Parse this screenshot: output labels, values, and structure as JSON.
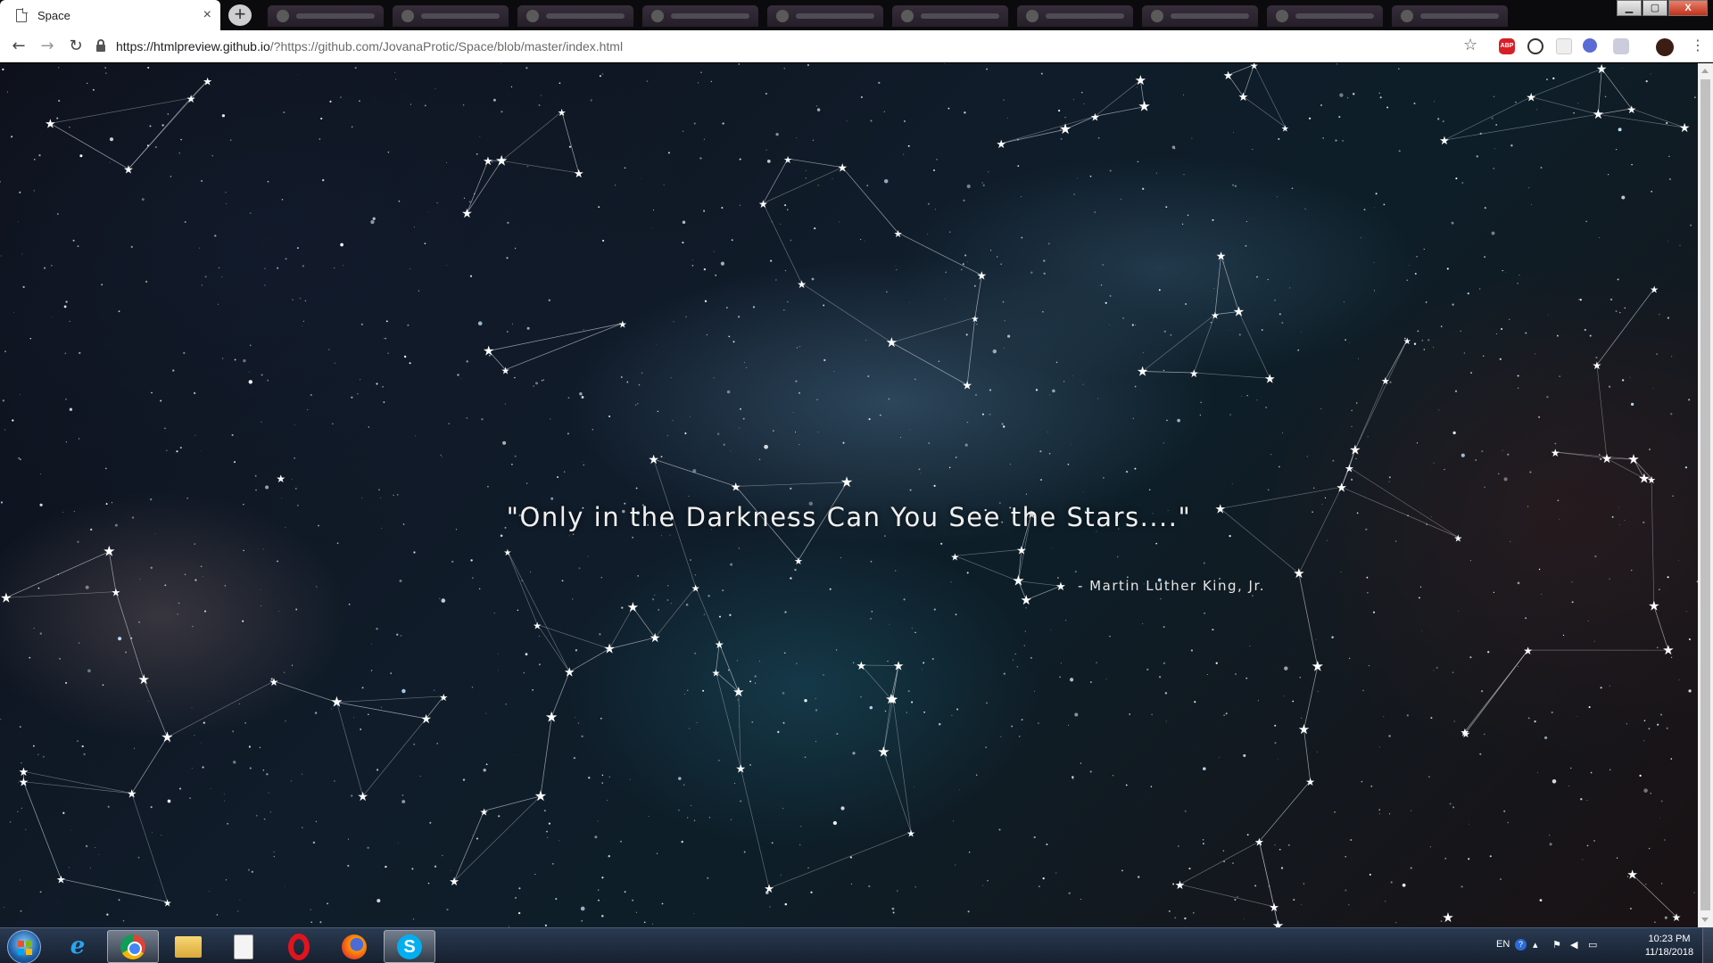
{
  "browser": {
    "tab_title": "Space",
    "tab_close": "×",
    "new_tab": "+",
    "url_host": "https://htmlpreview.github.io",
    "url_rest": "/?https://github.com/JovanaProtic/Space/blob/master/index.html",
    "back": "←",
    "forward": "→",
    "reload": "↻",
    "bookmark": "☆",
    "menu": "⋮",
    "abp_label": "ABP",
    "window_buttons": {
      "minimize": "▁",
      "maximize": "▢",
      "close": "X"
    }
  },
  "page": {
    "quote": "\"Only in the Darkness Can You See the Stars....\"",
    "author": "- Martin Luther King, Jr."
  },
  "taskbar": {
    "apps": [
      {
        "name": "internet-explorer",
        "icon": "e"
      },
      {
        "name": "chrome",
        "icon": ""
      },
      {
        "name": "file-explorer",
        "icon": ""
      },
      {
        "name": "notepad",
        "icon": ""
      },
      {
        "name": "opera",
        "icon": ""
      },
      {
        "name": "firefox",
        "icon": ""
      },
      {
        "name": "skype",
        "icon": "S"
      }
    ],
    "language": "EN",
    "help": "?",
    "time": "10:23 PM",
    "date": "11/18/2018"
  },
  "colors": {
    "quote_text": "#f0f0f0",
    "constellation_lines": "#c9ccd6",
    "sky_dark": "#0d0f18",
    "nebula_teal": "#1e5a6e"
  }
}
